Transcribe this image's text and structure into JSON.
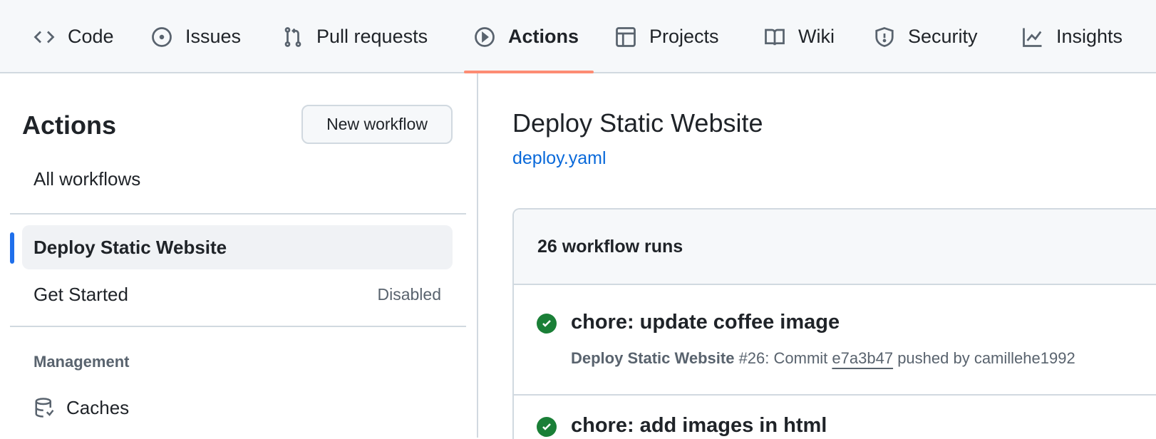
{
  "nav": {
    "tabs": [
      {
        "label": "Code",
        "icon": "code-icon"
      },
      {
        "label": "Issues",
        "icon": "issue-icon"
      },
      {
        "label": "Pull requests",
        "icon": "pull-request-icon"
      },
      {
        "label": "Actions",
        "icon": "play-icon",
        "active": true
      },
      {
        "label": "Projects",
        "icon": "table-icon"
      },
      {
        "label": "Wiki",
        "icon": "book-icon"
      },
      {
        "label": "Security",
        "icon": "shield-icon"
      },
      {
        "label": "Insights",
        "icon": "graph-icon"
      }
    ]
  },
  "sidebar": {
    "title": "Actions",
    "new_workflow": "New workflow",
    "all_workflows": "All workflows",
    "workflows": [
      {
        "label": "Deploy Static Website"
      },
      {
        "label": "Get Started",
        "badge": "Disabled"
      }
    ],
    "management_heading": "Management",
    "caches": "Caches"
  },
  "main": {
    "title": "Deploy Static Website",
    "file": "deploy.yaml",
    "runs_count": "26 workflow runs",
    "runs": [
      {
        "title": "chore: update coffee image",
        "workflow": "Deploy Static Website",
        "number": "#26: Commit",
        "sha": "e7a3b47",
        "pushed_by": "pushed by camillehe1992",
        "status": "success"
      },
      {
        "title": "chore: add images in html",
        "status": "success"
      }
    ]
  },
  "colors": {
    "accent": "#fd8c73",
    "selected": "#1f6feb",
    "success": "#1a7f37",
    "link": "#0969da"
  }
}
